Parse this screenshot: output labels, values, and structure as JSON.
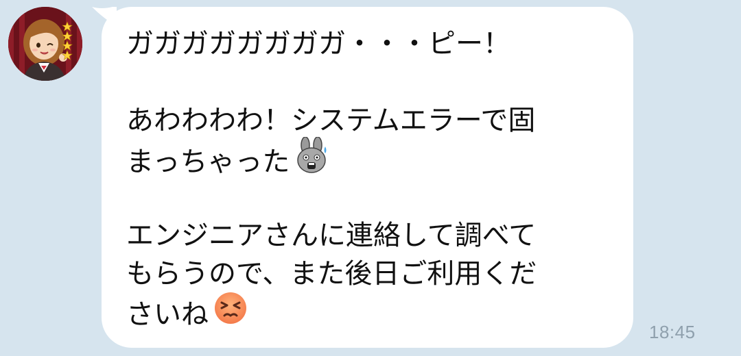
{
  "message": {
    "lines": [
      "ガガガガガガガガ・・・ピー！",
      "",
      "あわわわわ！システムエラーで固",
      "まっちゃった",
      "",
      "エンジニアさんに連絡して調べて",
      "もらうので、また後日ご利用くだ",
      "さいね"
    ],
    "emoji_1": "shocked-rabbit-sticker-icon",
    "emoji_2": "persevering-face-emoji"
  },
  "timestamp": "18:45",
  "colors": {
    "background": "#d6e4ee",
    "bubble": "#ffffff",
    "text": "#111111",
    "timestamp": "#8fa0ad"
  }
}
